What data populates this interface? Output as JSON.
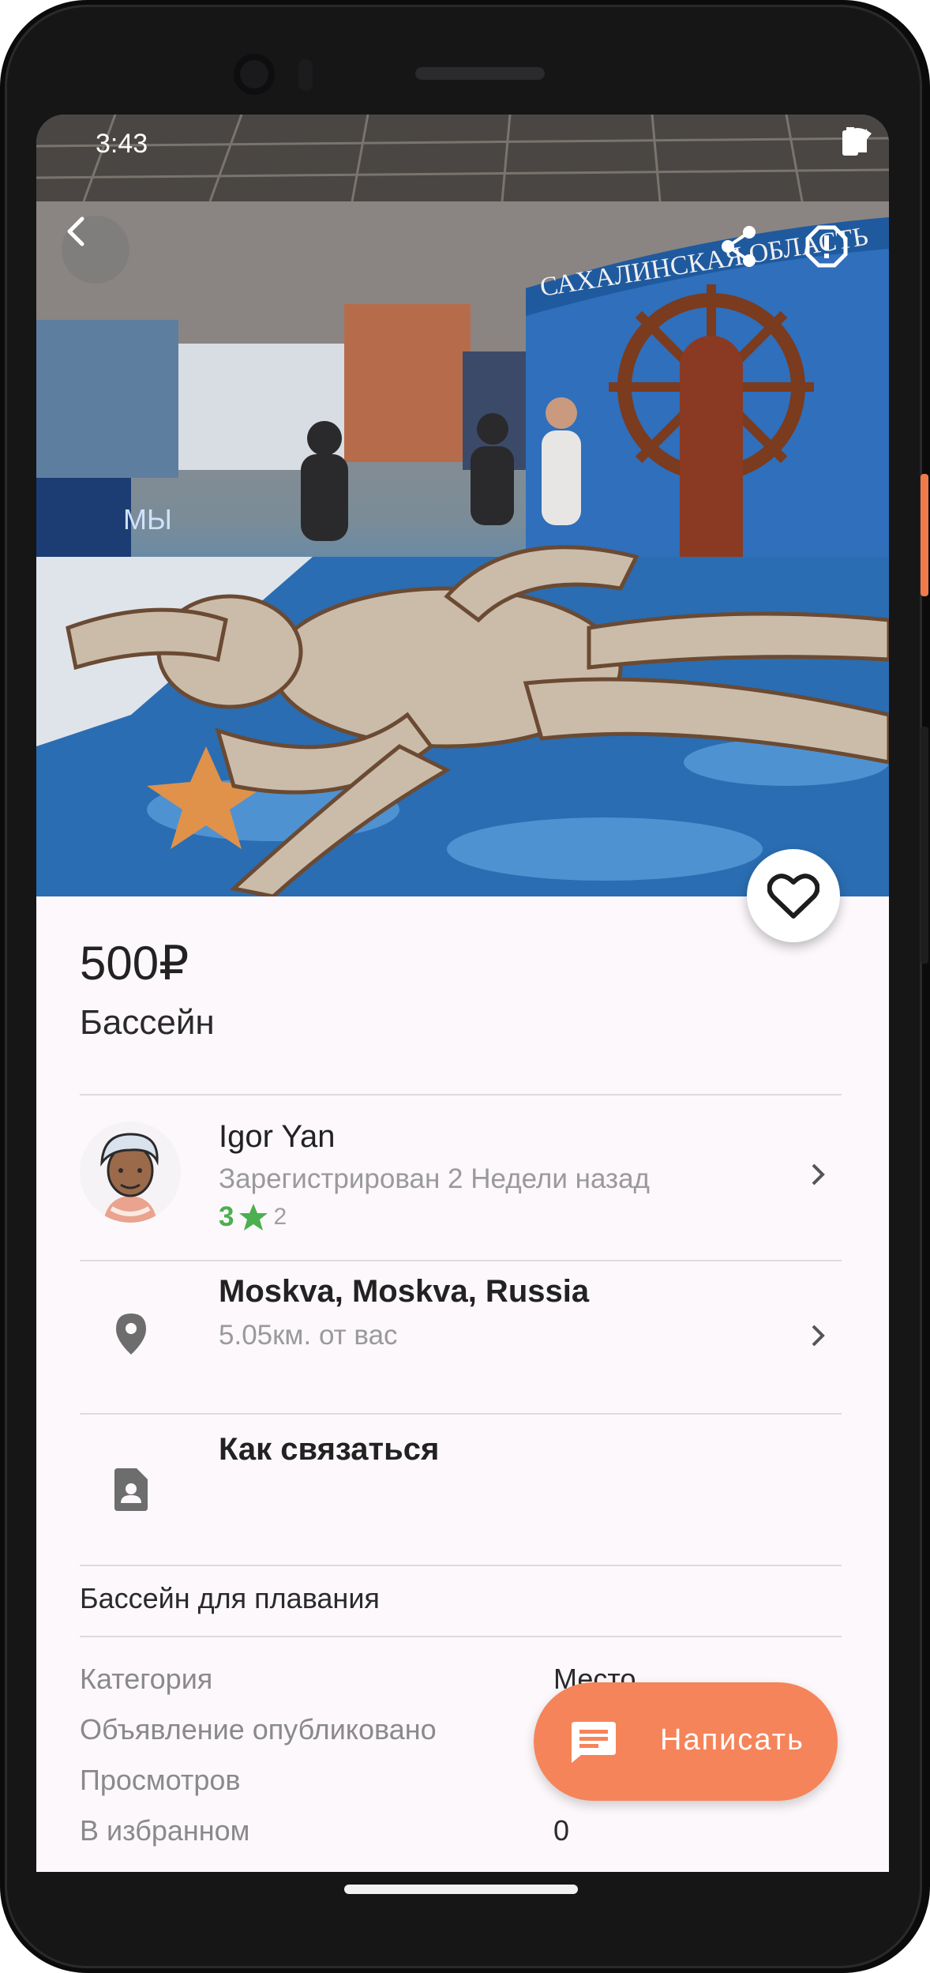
{
  "status_bar": {
    "time": "3:43"
  },
  "listing": {
    "price": "500₽",
    "title": "Бассейн",
    "description": "Бассейн для плавания"
  },
  "seller": {
    "name": "Igor Yan",
    "registered": "Зарегистрирован 2 Недели назад",
    "rating": "3",
    "reviews": "2"
  },
  "location": {
    "city": "Moskva, Moskva, Russia",
    "distance": "5.05км. от вас"
  },
  "contact": {
    "label": "Как связаться"
  },
  "properties": [
    {
      "name": "Категория",
      "value": "Место"
    },
    {
      "name": "Объявление опубликовано",
      "value": ""
    },
    {
      "name": "Просмотров",
      "value": ""
    },
    {
      "name": "В избранном",
      "value": "0"
    }
  ],
  "photo_sign_text": "САХАЛИНСКАЯ ОБЛАСТЬ",
  "photo_stand_text": "МЫ",
  "actions": {
    "write_label": "Написать"
  },
  "colors": {
    "accent": "#f5845a",
    "rating_green": "#4caf50",
    "side_button": "#f07a4a"
  },
  "icons": [
    "back-arrow-icon",
    "share-icon",
    "report-icon",
    "heart-icon",
    "chevron-right-icon",
    "location-pin-icon",
    "contact-card-icon",
    "message-icon",
    "star-icon",
    "wifi-icon",
    "signal-icon",
    "battery-icon"
  ]
}
